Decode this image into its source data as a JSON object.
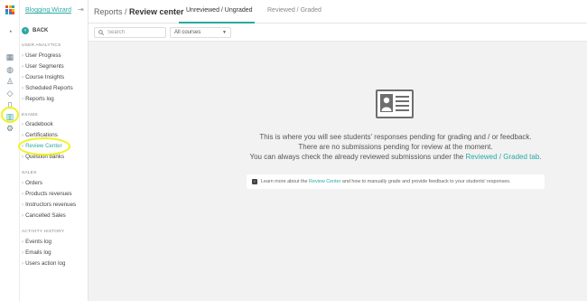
{
  "sidebar": {
    "brand": "Blogging Wizard",
    "back_label": "BACK",
    "sections": [
      {
        "title": "USER ANALYTICS",
        "items": [
          "User Progress",
          "User Segments",
          "Course Insights",
          "Scheduled Reports",
          "Reports log"
        ]
      },
      {
        "title": "EXAMS",
        "items": [
          "Gradebook",
          "Certifications",
          "Review Center",
          "Question banks"
        ]
      },
      {
        "title": "SALES",
        "items": [
          "Orders",
          "Products revenues",
          "Instructors revenues",
          "Cancelled Sales"
        ]
      },
      {
        "title": "ACTIVITY HISTORY",
        "items": [
          "Events log",
          "Emails log",
          "Users action log"
        ]
      }
    ],
    "active_item": "Review Center"
  },
  "header": {
    "breadcrumb_parent": "Reports",
    "breadcrumb_sep": " / ",
    "breadcrumb_current": "Review center",
    "tabs": [
      {
        "label": "Unreviewed / Ungraded",
        "active": true
      },
      {
        "label": "Reviewed / Graded",
        "active": false
      }
    ]
  },
  "filters": {
    "search_placeholder": "Search",
    "course_select": "All courses"
  },
  "empty_state": {
    "line1": "This is where you will see students' responses pending for grading and / or feedback.",
    "line2": "There are no submissions pending for review at the moment.",
    "line3_prefix": "You can always check the already reviewed submissions under the ",
    "line3_link": "Reviewed / Graded tab",
    "line3_suffix": "."
  },
  "info_bar": {
    "prefix": "Learn more about the ",
    "link": "Review Center",
    "suffix": " and how to manually grade and provide feedback to your students' responses."
  },
  "colors": {
    "accent": "#2aa9a3",
    "highlight": "#f2f21b",
    "main_bg": "#f2f2f2"
  }
}
